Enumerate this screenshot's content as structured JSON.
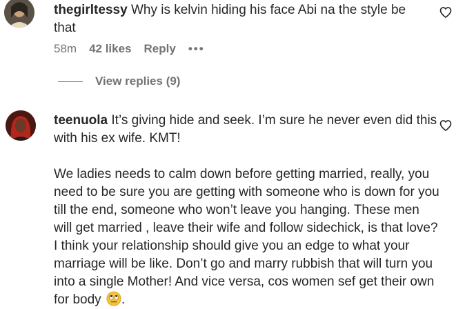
{
  "comments": [
    {
      "username": "thegirltessy",
      "text": "Why is kelvin hiding his face Abi na the style be that",
      "time": "58m",
      "likes": "42 likes",
      "reply_label": "Reply",
      "more_label": "•••",
      "view_replies": "View replies (9)",
      "avatar_icon": "user-avatar",
      "like_icon": "heart-outline-icon"
    },
    {
      "username": "teenuola",
      "text_line1": "It’s giving hide and seek. I’m sure he never even did this with his ex wife. KMT!",
      "text_para2": "We ladies needs to calm down before getting married, really, you need to be sure you are getting with someone who is down for you till the end, someone who won’t leave you hanging. These men will get married , leave their wife and follow sidechick, is that love? I think your relationship should give you an edge to what your marriage will be like. Don’t go and marry rubbish that will turn you into a single Mother! And vice versa, cos women sef get their own for body",
      "text_end": ".",
      "emoji_icon": "eye-roll-emoji",
      "avatar_icon": "user-avatar",
      "like_icon": "heart-outline-icon"
    }
  ],
  "colors": {
    "text_primary": "#262626",
    "text_secondary": "#737373",
    "background": "#ffffff"
  }
}
